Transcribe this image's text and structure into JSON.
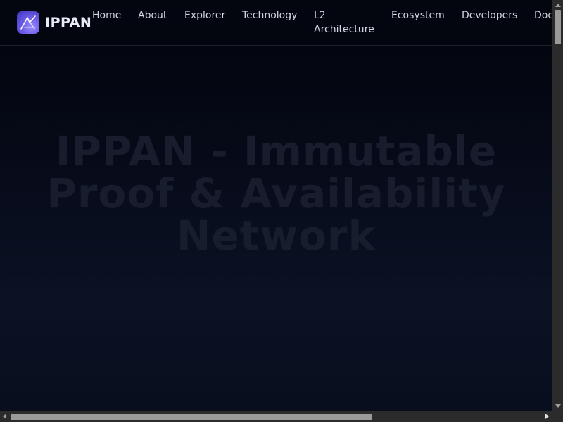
{
  "brand": {
    "name": "IPPAN",
    "logo_icon": "ippan-logo-icon"
  },
  "nav": {
    "items": [
      {
        "label": "Home"
      },
      {
        "label": "About"
      },
      {
        "label": "Explorer"
      },
      {
        "label": "Technology"
      },
      {
        "label": "L2 Architecture"
      },
      {
        "label": "Ecosystem"
      },
      {
        "label": "Developers"
      },
      {
        "label": "Docs"
      }
    ]
  },
  "hero": {
    "title": "IPPAN - Immutable Proof & Availability Network"
  },
  "colors": {
    "background": "#03050f",
    "hero_text": "#171d2d",
    "logo_gradient_start": "#9a8cff",
    "logo_gradient_end": "#3c35b8"
  }
}
